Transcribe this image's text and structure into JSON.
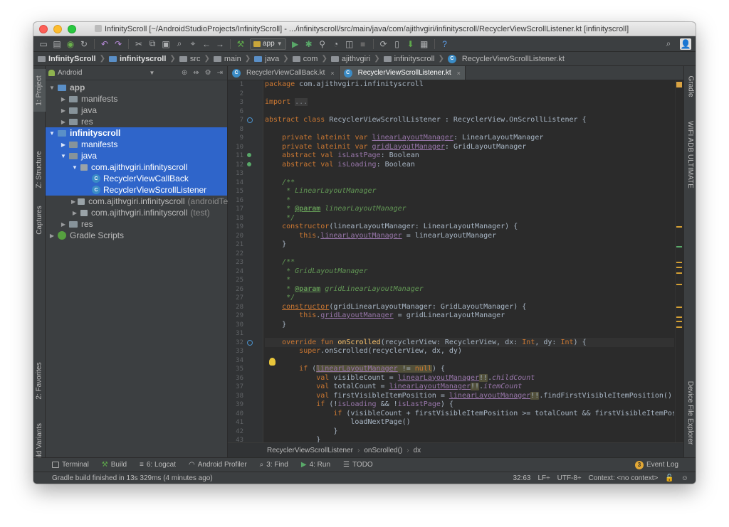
{
  "window": {
    "title": "InfinityScroll [~/AndroidStudioProjects/InfinityScroll] - .../infinityscroll/src/main/java/com/ajithvgiri/infinityscroll/RecyclerViewScrollListener.kt [infinityscroll]"
  },
  "toolbar": {
    "run_config": "app",
    "icons": [
      "folder-icon",
      "save-icon",
      "sync-icon",
      "refresh-icon",
      "back-icon",
      "forward-icon",
      "cut-icon",
      "copy-icon",
      "paste-icon",
      "find-icon",
      "replace-icon",
      "back-nav-icon",
      "forward-nav-icon",
      "build-icon",
      "run-icon",
      "debug-icon",
      "attach-icon",
      "profile-icon",
      "coverage-icon",
      "stop-icon",
      "sync-gradle-icon",
      "avd-icon",
      "sdk-icon",
      "layout-icon",
      "help-icon",
      "search-icon",
      "user-icon"
    ]
  },
  "navbar": {
    "crumbs": [
      "InfinityScroll",
      "infinityscroll",
      "src",
      "main",
      "java",
      "com",
      "ajithvgiri",
      "infinityscroll",
      "RecyclerViewScrollListener.kt"
    ]
  },
  "left_strip": {
    "project": "1: Project",
    "structure": "Z: Structure",
    "captures": "Captures",
    "favorites": "2: Favorites",
    "build_variants": "Build Variants"
  },
  "right_strip": {
    "gradle": "Gradle",
    "wifi_adb": "WIFI ADB ULTIMATE",
    "device_explorer": "Device File Explorer"
  },
  "project": {
    "view_mode": "Android",
    "tree": [
      {
        "label": "app",
        "indent": 0,
        "arrow": "▼",
        "icon": "folder-blue",
        "bold": true
      },
      {
        "label": "manifests",
        "indent": 1,
        "arrow": "▶",
        "icon": "folder"
      },
      {
        "label": "java",
        "indent": 1,
        "arrow": "▶",
        "icon": "folder"
      },
      {
        "label": "res",
        "indent": 1,
        "arrow": "▶",
        "icon": "folder"
      },
      {
        "label": "infinityscroll",
        "indent": 0,
        "arrow": "▼",
        "icon": "folder-blue",
        "bold": true,
        "selected": true
      },
      {
        "label": "manifests",
        "indent": 1,
        "arrow": "▶",
        "icon": "folder",
        "selected": true
      },
      {
        "label": "java",
        "indent": 1,
        "arrow": "▼",
        "icon": "folder",
        "selected": true
      },
      {
        "label": "com.ajithvgiri.infinityscroll",
        "indent": 2,
        "arrow": "▼",
        "icon": "package",
        "selected": true
      },
      {
        "label": "RecyclerViewCallBack",
        "indent": 3,
        "arrow": "",
        "icon": "kotlin",
        "selected": true
      },
      {
        "label": "RecyclerViewScrollListener",
        "indent": 3,
        "arrow": "",
        "icon": "kotlin",
        "selected": true
      },
      {
        "label": "com.ajithvgiri.infinityscroll",
        "suffix": "(androidTe",
        "indent": 2,
        "arrow": "▶",
        "icon": "package"
      },
      {
        "label": "com.ajithvgiri.infinityscroll",
        "suffix": "(test)",
        "indent": 2,
        "arrow": "▶",
        "icon": "package"
      },
      {
        "label": "res",
        "indent": 1,
        "arrow": "▶",
        "icon": "folder"
      },
      {
        "label": "Gradle Scripts",
        "indent": 0,
        "arrow": "▶",
        "icon": "gradle"
      }
    ]
  },
  "editor": {
    "tabs": [
      {
        "label": "RecyclerViewCallBack.kt",
        "active": false
      },
      {
        "label": "RecyclerViewScrollListener.kt",
        "active": true
      }
    ],
    "line_numbers": [
      "1",
      "2",
      "3",
      "6",
      "7",
      "8",
      "9",
      "10",
      "11",
      "12",
      "13",
      "14",
      "15",
      "16",
      "17",
      "18",
      "19",
      "20",
      "21",
      "22",
      "23",
      "24",
      "25",
      "26",
      "27",
      "28",
      "29",
      "30",
      "31",
      "32",
      "33",
      "34",
      "35",
      "36",
      "37",
      "38",
      "39",
      "40",
      "41",
      "42",
      "43"
    ],
    "breadcrumbs": [
      "RecyclerViewScrollListener",
      "onScrolled()",
      "dx"
    ]
  },
  "bottom_tabs": [
    {
      "label": "Terminal",
      "icon": "terminal-icon"
    },
    {
      "label": "Build",
      "icon": "build-icon"
    },
    {
      "label": "6: Logcat",
      "icon": "logcat-icon"
    },
    {
      "label": "Android Profiler",
      "icon": "profiler-icon"
    },
    {
      "label": "3: Find",
      "icon": "find-icon"
    },
    {
      "label": "4: Run",
      "icon": "run-icon"
    },
    {
      "label": "TODO",
      "icon": "todo-icon"
    }
  ],
  "event_log": {
    "label": "Event Log",
    "count": "3"
  },
  "status": {
    "message": "Gradle build finished in 13s 329ms (4 minutes ago)",
    "position": "32:63",
    "line_sep": "LF÷",
    "encoding": "UTF-8÷",
    "context": "Context: <no context>"
  }
}
